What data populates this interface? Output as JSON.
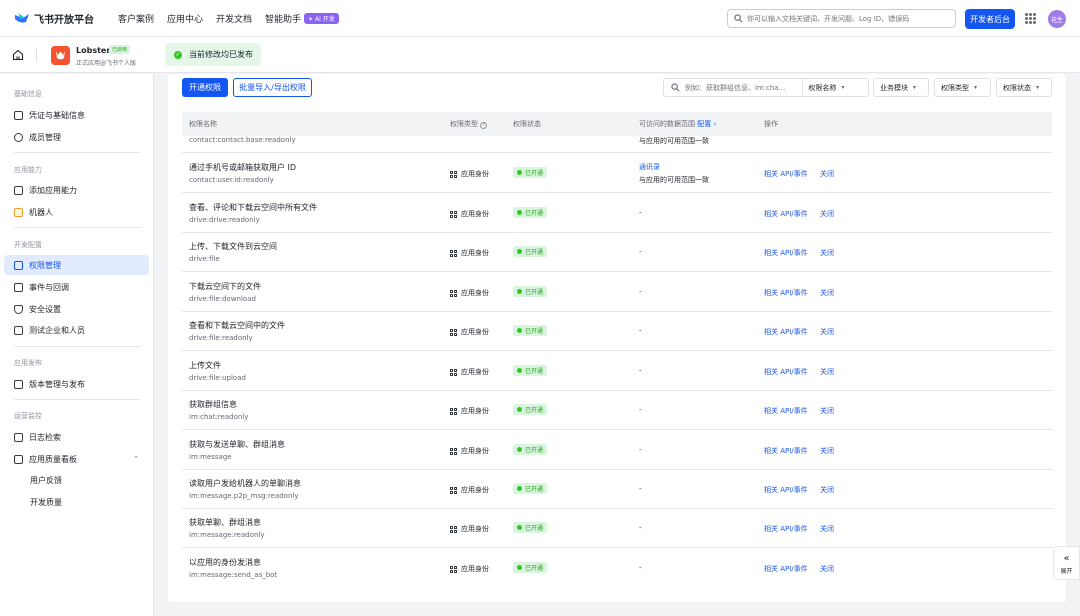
{
  "header": {
    "brand": "飞书开放平台",
    "nav": [
      "客户案例",
      "应用中心",
      "开发文档",
      "智能助手"
    ],
    "ai_badge": "✦ AI 开发",
    "search_placeholder": "你可以输入文档关键词、开发问题、Log ID、错误码",
    "console_button": "开发者后台",
    "avatar_text": "花生"
  },
  "app": {
    "name": "Lobster",
    "badge": "已启用",
    "subtitle": "正式应用@飞书个人版",
    "publish_status": "当前修改均已发布"
  },
  "sidebar": {
    "groups": [
      {
        "label": "基础信息",
        "items": [
          {
            "label": "凭证与基础信息",
            "icon": "credential-icon"
          },
          {
            "label": "成员管理",
            "icon": "member-icon"
          }
        ]
      },
      {
        "label": "应用能力",
        "items": [
          {
            "label": "添加应用能力",
            "icon": "add-capability-icon"
          },
          {
            "label": "机器人",
            "icon": "robot-icon"
          }
        ]
      },
      {
        "label": "开发配置",
        "items": [
          {
            "label": "权限管理",
            "icon": "permission-icon"
          },
          {
            "label": "事件与回调",
            "icon": "event-icon"
          },
          {
            "label": "安全设置",
            "icon": "shield-icon"
          },
          {
            "label": "测试企业和人员",
            "icon": "test-icon"
          }
        ]
      },
      {
        "label": "应用发布",
        "items": [
          {
            "label": "版本管理与发布",
            "icon": "release-icon"
          }
        ]
      },
      {
        "label": "运营监控",
        "items": [
          {
            "label": "日志检索",
            "icon": "log-icon"
          },
          {
            "label": "应用质量看板",
            "icon": "quality-icon"
          }
        ]
      }
    ],
    "quality_sub": [
      "用户反馈",
      "开发质量"
    ],
    "active": "权限管理"
  },
  "toolbar": {
    "enable_button": "开通权限",
    "batch_button": "批量导入/导出权限",
    "search_placeholder": "例如：获取群组信息、im:cha...",
    "search_field": "权限名称",
    "filters": [
      "业务模块",
      "权限类型",
      "权限状态"
    ]
  },
  "table": {
    "headers": {
      "name": "权限名称",
      "type": "权限类型",
      "status": "权限状态",
      "data": "可访问的数据范围",
      "config": "配置",
      "action": "操作"
    },
    "partial_row": {
      "scope": "contact:contact.base:readonly",
      "data": "与应用的可用范围一致"
    },
    "rows": [
      {
        "name": "通过手机号或邮箱获取用户 ID",
        "scope": "contact:user.id:readonly",
        "type": "应用身份",
        "status": "已开通",
        "data_link": "通讯录",
        "data": "与应用的可用范围一致",
        "api": "相关 API/事件",
        "close": "关闭"
      },
      {
        "name": "查看、评论和下载云空间中所有文件",
        "scope": "drive:drive:readonly",
        "type": "应用身份",
        "status": "已开通",
        "data": "-",
        "api": "相关 API/事件",
        "close": "关闭"
      },
      {
        "name": "上传、下载文件到云空间",
        "scope": "drive:file",
        "type": "应用身份",
        "status": "已开通",
        "data": "-",
        "api": "相关 API/事件",
        "close": "关闭"
      },
      {
        "name": "下载云空间下的文件",
        "scope": "drive:file:download",
        "type": "应用身份",
        "status": "已开通",
        "data": "-",
        "api": "相关 API/事件",
        "close": "关闭"
      },
      {
        "name": "查看和下载云空间中的文件",
        "scope": "drive:file:readonly",
        "type": "应用身份",
        "status": "已开通",
        "data": "-",
        "api": "相关 API/事件",
        "close": "关闭"
      },
      {
        "name": "上传文件",
        "scope": "drive:file:upload",
        "type": "应用身份",
        "status": "已开通",
        "data": "-",
        "api": "相关 API/事件",
        "close": "关闭"
      },
      {
        "name": "获取群组信息",
        "scope": "im:chat:readonly",
        "type": "应用身份",
        "status": "已开通",
        "data": "-",
        "api": "相关 API/事件",
        "close": "关闭"
      },
      {
        "name": "获取与发送单聊、群组消息",
        "scope": "im:message",
        "type": "应用身份",
        "status": "已开通",
        "data": "-",
        "api": "相关 API/事件",
        "close": "关闭"
      },
      {
        "name": "读取用户发给机器人的单聊消息",
        "scope": "im:message.p2p_msg:readonly",
        "type": "应用身份",
        "status": "已开通",
        "data": "-",
        "api": "相关 API/事件",
        "close": "关闭"
      },
      {
        "name": "获取单聊、群组消息",
        "scope": "im:message:readonly",
        "type": "应用身份",
        "status": "已开通",
        "data": "-",
        "api": "相关 API/事件",
        "close": "关闭"
      },
      {
        "name": "以应用的身份发消息",
        "scope": "im:message:send_as_bot",
        "type": "应用身份",
        "status": "已开通",
        "data": "-",
        "api": "相关 API/事件",
        "close": "关闭"
      }
    ]
  },
  "expand_label": "展开",
  "colors": {
    "primary": "#1456f0",
    "success": "#34c724",
    "success_bg": "#d9f5e0"
  }
}
